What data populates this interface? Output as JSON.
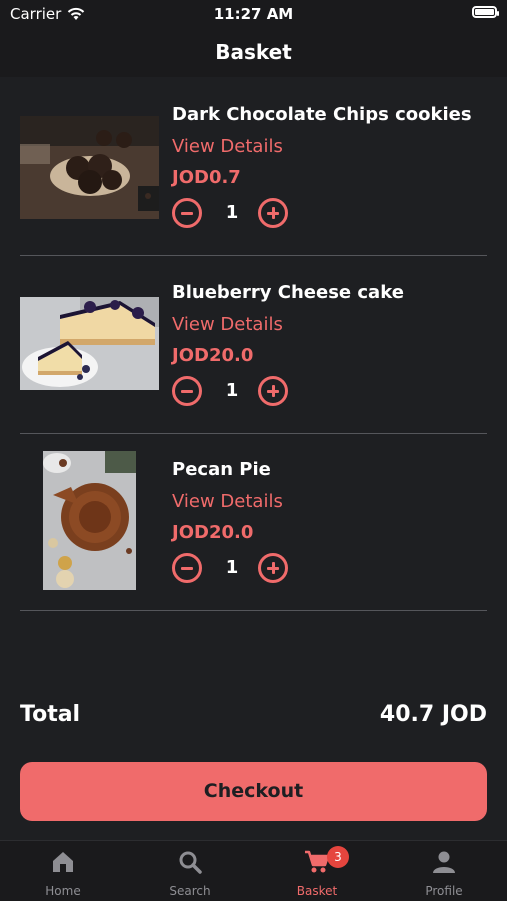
{
  "status_bar": {
    "carrier": "Carrier",
    "time": "11:27 AM"
  },
  "nav": {
    "title": "Basket"
  },
  "items": [
    {
      "name": "Dark Chocolate Chips cookies",
      "details_label": "View Details",
      "price": "JOD0.7",
      "quantity": "1"
    },
    {
      "name": "Blueberry Cheese cake",
      "details_label": "View Details",
      "price": "JOD20.0",
      "quantity": "1"
    },
    {
      "name": "Pecan Pie",
      "details_label": "View Details",
      "price": "JOD20.0",
      "quantity": "1"
    }
  ],
  "total": {
    "label": "Total",
    "value": "40.7 JOD"
  },
  "checkout_label": "Checkout",
  "tabs": [
    {
      "label": "Home",
      "icon": "home-icon"
    },
    {
      "label": "Search",
      "icon": "search-icon"
    },
    {
      "label": "Basket",
      "icon": "cart-icon",
      "badge": "3",
      "active": true
    },
    {
      "label": "Profile",
      "icon": "person-icon"
    }
  ],
  "colors": {
    "accent": "#f06b6b",
    "background": "#1e1f22",
    "badge": "#e5453e"
  }
}
